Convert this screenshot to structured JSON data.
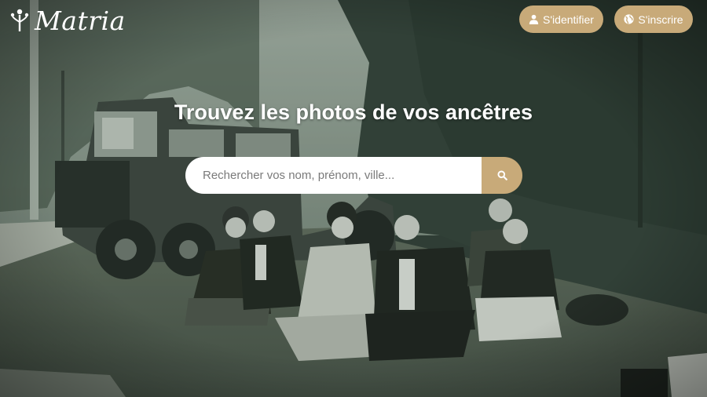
{
  "brand": {
    "name": "Matria"
  },
  "header": {
    "login_label": "S'identifier",
    "signup_label": "S'inscrire"
  },
  "hero": {
    "headline": "Trouvez les photos de vos ancêtres",
    "search": {
      "placeholder": "Rechercher vos nom, prénom, ville...",
      "value": ""
    }
  },
  "icons": {
    "logo": "tree-figure-icon",
    "login": "user-icon",
    "signup": "globe-icon",
    "search": "search-icon"
  },
  "colors": {
    "accent": "#c8aa79",
    "text_light": "#ffffff",
    "photo_tint": "#3e4f45"
  }
}
